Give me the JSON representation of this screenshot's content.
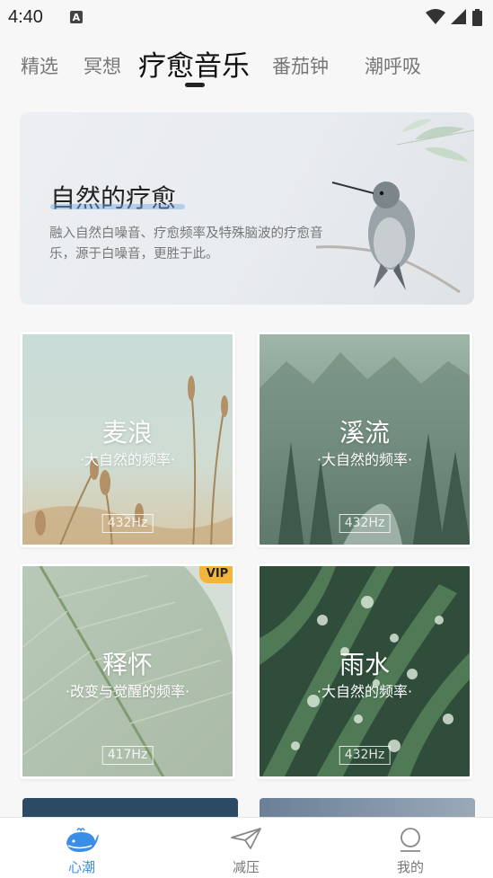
{
  "status_bar": {
    "time": "4:40",
    "notification_letter": "A"
  },
  "tabs": [
    {
      "label": "精选",
      "active": false
    },
    {
      "label": "冥想",
      "active": false
    },
    {
      "label": "疗愈音乐",
      "active": true
    },
    {
      "label": "番茄钟",
      "active": false
    },
    {
      "label": "潮呼吸",
      "active": false
    }
  ],
  "hero": {
    "title": "自然的疗愈",
    "description": "融入自然白噪音、疗愈频率及特殊脑波的疗愈音乐，源于白噪音，更胜于此。",
    "image": "hummingbird-on-branch"
  },
  "cards": [
    {
      "title": "麦浪",
      "subtitle": "·大自然的频率·",
      "hz": "432Hz",
      "vip": false,
      "image": "wheat-field"
    },
    {
      "title": "溪流",
      "subtitle": "·大自然的频率·",
      "hz": "432Hz",
      "vip": false,
      "image": "misty-forest-stream"
    },
    {
      "title": "释怀",
      "subtitle": "·改变与觉醒的频率·",
      "hz": "417Hz",
      "vip": true,
      "vip_label": "VIP",
      "image": "leaf-closeup"
    },
    {
      "title": "雨水",
      "subtitle": "·大自然的频率·",
      "hz": "432Hz",
      "vip": false,
      "image": "raindrops-on-leaves"
    }
  ],
  "bottom_nav": [
    {
      "label": "心潮",
      "icon": "whale-icon",
      "active": true
    },
    {
      "label": "减压",
      "icon": "paper-plane-icon",
      "active": false
    },
    {
      "label": "我的",
      "icon": "profile-icon",
      "active": false
    }
  ],
  "colors": {
    "accent": "#3a8ee8",
    "vip": "#f2b53a"
  }
}
